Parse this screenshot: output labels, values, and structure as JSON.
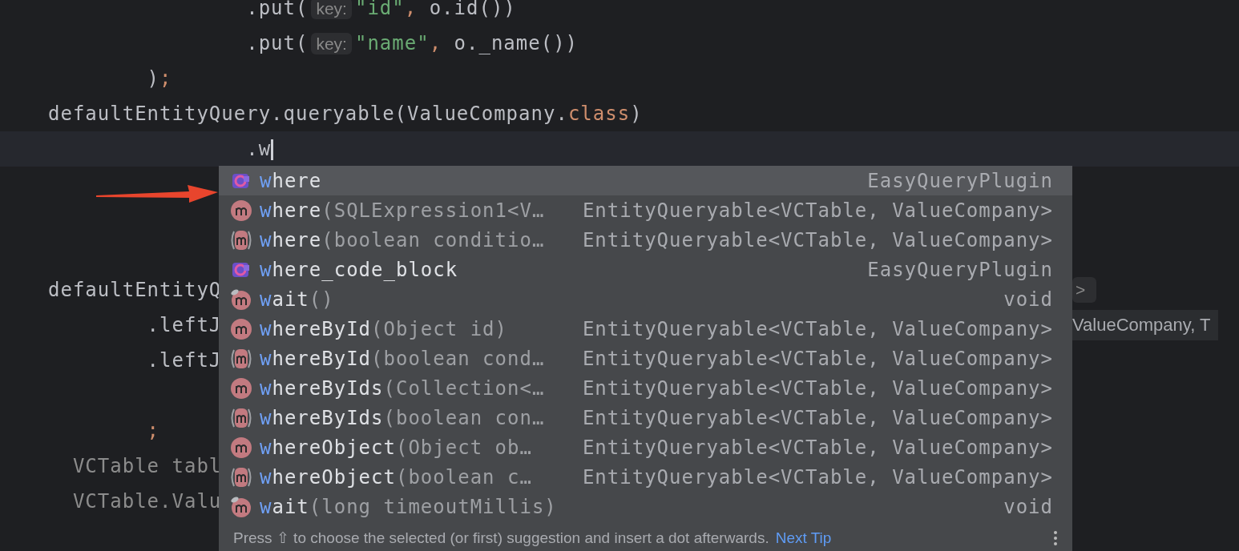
{
  "editor": {
    "lines": [
      {
        "kind": "chain",
        "tokens": [
          {
            "kind": "plain",
            "text": ".put("
          },
          {
            "kind": "hint",
            "text": "key:"
          },
          {
            "kind": "string",
            "text": "\"id\""
          },
          {
            "kind": "keyword",
            "text": ", "
          },
          {
            "kind": "plain",
            "text": "o.id())"
          }
        ]
      },
      {
        "kind": "chain",
        "tokens": [
          {
            "kind": "plain",
            "text": ".put("
          },
          {
            "kind": "hint",
            "text": "key:"
          },
          {
            "kind": "string",
            "text": "\"name\""
          },
          {
            "kind": "keyword",
            "text": ", "
          },
          {
            "kind": "plain",
            "text": "o._name())"
          }
        ]
      },
      {
        "kind": "block",
        "tokens": [
          {
            "kind": "plain",
            "text": ")"
          },
          {
            "kind": "keyword",
            "text": ";"
          }
        ]
      },
      {
        "kind": "top",
        "tokens": [
          {
            "kind": "plain",
            "text": "defaultEntityQuery.queryable(ValueCompany."
          },
          {
            "kind": "keyword",
            "text": "class"
          },
          {
            "kind": "plain",
            "text": ")"
          }
        ]
      },
      {
        "kind": "chain",
        "current": true,
        "tokens": [
          {
            "kind": "plain",
            "text": ".w"
          }
        ]
      },
      {
        "kind": "blank"
      },
      {
        "kind": "blank"
      },
      {
        "kind": "blank"
      },
      {
        "kind": "top",
        "tokens": [
          {
            "kind": "plain",
            "text": "defaultEntityQ"
          }
        ],
        "right": {
          "kind": "hintbox",
          "text": ">"
        }
      },
      {
        "kind": "block",
        "tokens": [
          {
            "kind": "plain",
            "text": ".leftJ"
          }
        ],
        "right": {
          "kind": "hintline",
          "text": "ValueCompany, T"
        }
      },
      {
        "kind": "block",
        "tokens": [
          {
            "kind": "plain",
            "text": ".leftJ"
          }
        ]
      },
      {
        "kind": "blank"
      },
      {
        "kind": "block",
        "tokens": [
          {
            "kind": "keyword",
            "text": ";"
          }
        ]
      },
      {
        "kind": "local",
        "tokens": [
          {
            "kind": "dim",
            "text": "VCTable tabl"
          }
        ]
      },
      {
        "kind": "local",
        "tokens": [
          {
            "kind": "dim",
            "text": "VCTable.Valu"
          }
        ]
      }
    ]
  },
  "completion": {
    "items": [
      {
        "kind": "plugin",
        "selected": true,
        "name_match": "w",
        "name_rest": "here",
        "type": "EasyQueryPlugin"
      },
      {
        "kind": "method",
        "selected": false,
        "name_match": "w",
        "name_rest": "here",
        "params": "(SQLExpression1<V…",
        "type": "EntityQueryable<VCTable, ValueCompany>"
      },
      {
        "kind": "method-overload",
        "selected": false,
        "name_match": "w",
        "name_rest": "here",
        "params": "(boolean conditio…",
        "type": "EntityQueryable<VCTable, ValueCompany>"
      },
      {
        "kind": "plugin",
        "selected": false,
        "name_match": "w",
        "name_rest": "here_code_block",
        "type": "EasyQueryPlugin"
      },
      {
        "kind": "method-pinned",
        "selected": false,
        "name_match": "w",
        "name_rest": "ait",
        "params": "()",
        "type": "void"
      },
      {
        "kind": "method",
        "selected": false,
        "name_match": "w",
        "name_rest": "hereById",
        "params": "(Object id)",
        "type": "EntityQueryable<VCTable, ValueCompany>"
      },
      {
        "kind": "method-overload",
        "selected": false,
        "name_match": "w",
        "name_rest": "hereById",
        "params": "(boolean cond…",
        "type": "EntityQueryable<VCTable, ValueCompany>"
      },
      {
        "kind": "method",
        "selected": false,
        "name_match": "w",
        "name_rest": "hereByIds",
        "params": "(Collection<…",
        "type": "EntityQueryable<VCTable, ValueCompany>"
      },
      {
        "kind": "method-overload",
        "selected": false,
        "name_match": "w",
        "name_rest": "hereByIds",
        "params": "(boolean con…",
        "type": "EntityQueryable<VCTable, ValueCompany>"
      },
      {
        "kind": "method",
        "selected": false,
        "name_match": "w",
        "name_rest": "hereObject",
        "params": "(Object ob…",
        "type": "EntityQueryable<VCTable, ValueCompany>"
      },
      {
        "kind": "method-overload",
        "selected": false,
        "name_match": "w",
        "name_rest": "hereObject",
        "params": "(boolean c…",
        "type": "EntityQueryable<VCTable, ValueCompany>"
      },
      {
        "kind": "method-pinned",
        "selected": false,
        "name_match": "w",
        "name_rest": "ait",
        "params": "(long timeoutMillis)",
        "type": "void"
      }
    ],
    "footer": {
      "text": "Press ⇧ to choose the selected (or first) suggestion and insert a dot afterwards.",
      "link": "Next Tip"
    }
  }
}
